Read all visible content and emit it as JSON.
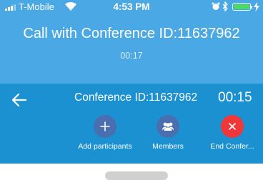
{
  "status_bar": {
    "carrier": "T-Mobile",
    "time": "4:53 PM",
    "battery_color": "#4cd964"
  },
  "call": {
    "title": "Call with Conference ID:11637962",
    "timer": "00:17"
  },
  "panel": {
    "conference_id": "Conference ID:11637962",
    "timer": "00:15",
    "back_icon": "arrow-left-icon",
    "actions": [
      {
        "label": "Add participants",
        "icon": "plus-icon",
        "color": "#4a6fb0"
      },
      {
        "label": "Members",
        "icon": "members-icon",
        "color": "#4a6fb0"
      },
      {
        "label": "End Confer...",
        "icon": "close-icon",
        "color": "#f2373b"
      }
    ]
  },
  "colors": {
    "header": "#4aa8e4",
    "panel": "#1b91d1"
  }
}
